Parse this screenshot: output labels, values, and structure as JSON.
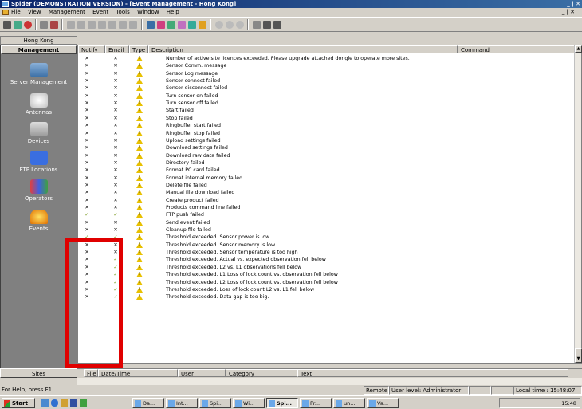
{
  "window": {
    "title": "Spider  (DEMONSTRATION VERSION) - [Event Management - Hong Kong]",
    "controls": "_ | ✕"
  },
  "menu": [
    "File",
    "View",
    "Management",
    "Event",
    "Tools",
    "Window",
    "Help"
  ],
  "sidebar": {
    "header": "Hong Kong",
    "section": "Management",
    "items": [
      {
        "label": "Server Management",
        "icon": "server-icon"
      },
      {
        "label": "Antennas",
        "icon": "antenna-icon"
      },
      {
        "label": "Devices",
        "icon": "devices-icon"
      },
      {
        "label": "FTP Locations",
        "icon": "ftp-icon"
      },
      {
        "label": "Operators",
        "icon": "operators-icon"
      },
      {
        "label": "Events",
        "icon": "events-icon"
      }
    ],
    "bottom_tab": "Sites"
  },
  "table": {
    "columns": [
      "Notify",
      "Email",
      "Type",
      "Description",
      "Command"
    ],
    "rows": [
      {
        "notify": "✕",
        "email": "✕",
        "desc": "Number of active site licences exceeded. Please upgrade attached dongle to operate more sites."
      },
      {
        "notify": "✕",
        "email": "✕",
        "desc": "Sensor Comm. message"
      },
      {
        "notify": "✕",
        "email": "✕",
        "desc": "Sensor Log message"
      },
      {
        "notify": "✕",
        "email": "✕",
        "desc": "Sensor connect failed"
      },
      {
        "notify": "✕",
        "email": "✕",
        "desc": "Sensor disconnect failed"
      },
      {
        "notify": "✕",
        "email": "✕",
        "desc": "Turn sensor on failed"
      },
      {
        "notify": "✕",
        "email": "✕",
        "desc": "Turn sensor off failed"
      },
      {
        "notify": "✕",
        "email": "✕",
        "desc": "Start failed"
      },
      {
        "notify": "✕",
        "email": "✕",
        "desc": "Stop failed"
      },
      {
        "notify": "✕",
        "email": "✕",
        "desc": "Ringbuffer start failed"
      },
      {
        "notify": "✕",
        "email": "✕",
        "desc": "Ringbuffer stop failed"
      },
      {
        "notify": "✕",
        "email": "✕",
        "desc": "Upload settings failed"
      },
      {
        "notify": "✕",
        "email": "✕",
        "desc": "Download settings failed"
      },
      {
        "notify": "✕",
        "email": "✕",
        "desc": "Download raw data failed"
      },
      {
        "notify": "✕",
        "email": "✕",
        "desc": "Directory failed"
      },
      {
        "notify": "✕",
        "email": "✕",
        "desc": "Format PC card failed"
      },
      {
        "notify": "✕",
        "email": "✕",
        "desc": "Format internal memory failed"
      },
      {
        "notify": "✕",
        "email": "✕",
        "desc": "Delete file failed"
      },
      {
        "notify": "✕",
        "email": "✕",
        "desc": "Manual file download failed"
      },
      {
        "notify": "✕",
        "email": "✕",
        "desc": "Create product failed"
      },
      {
        "notify": "✕",
        "email": "✕",
        "desc": "Products command line failed"
      },
      {
        "notify": "✓",
        "email": "✓",
        "desc": "FTP push failed"
      },
      {
        "notify": "✕",
        "email": "✕",
        "desc": "Send event failed"
      },
      {
        "notify": "✕",
        "email": "✕",
        "desc": "Cleanup file failed"
      },
      {
        "notify": "✓",
        "email": "✓",
        "desc": "Threshold exceeded. Sensor power is low"
      },
      {
        "notify": "✕",
        "email": "✕",
        "desc": "Threshold exceeded. Sensor memory is low"
      },
      {
        "notify": "✕",
        "email": "✕",
        "desc": "Threshold exceeded. Sensor temperature is too high"
      },
      {
        "notify": "✕",
        "email": "✓",
        "desc": "Threshold exceeded. Actual vs. expected observation fell below"
      },
      {
        "notify": "✕",
        "email": "✓",
        "desc": "Threshold exceeded. L2 vs. L1 observations fell below"
      },
      {
        "notify": "✕",
        "email": "✓",
        "desc": "Threshold exceeded. L1 Loss of lock count vs. observation fell below"
      },
      {
        "notify": "✕",
        "email": "✓",
        "desc": "Threshold exceeded. L2 Loss of lock count vs. observation fell below"
      },
      {
        "notify": "✕",
        "email": "✓",
        "desc": "Threshold exceeded. Loss of lock count L2 vs. L1 fell below"
      },
      {
        "notify": "✕",
        "email": "✓",
        "desc": "Threshold exceeded. Data gap is too big."
      }
    ]
  },
  "bottom_columns": [
    "File",
    "Date/Time",
    "User",
    "Category",
    "Text"
  ],
  "statusbar": {
    "help": "For Help, press F1",
    "remote": "Remote",
    "user_level": "User level: Administrator",
    "local_time": "Local time : 15:48:07"
  },
  "taskbar": {
    "start": "Start",
    "tasks": [
      "Da...",
      "Int...",
      "Spi...",
      "Wi...",
      "Spi...",
      "Pr...",
      "un...",
      "Va..."
    ],
    "clock": "15:48"
  },
  "colors": {
    "check": "#7a9a20",
    "highlight": "#e00000",
    "warning": "#e8c000"
  }
}
